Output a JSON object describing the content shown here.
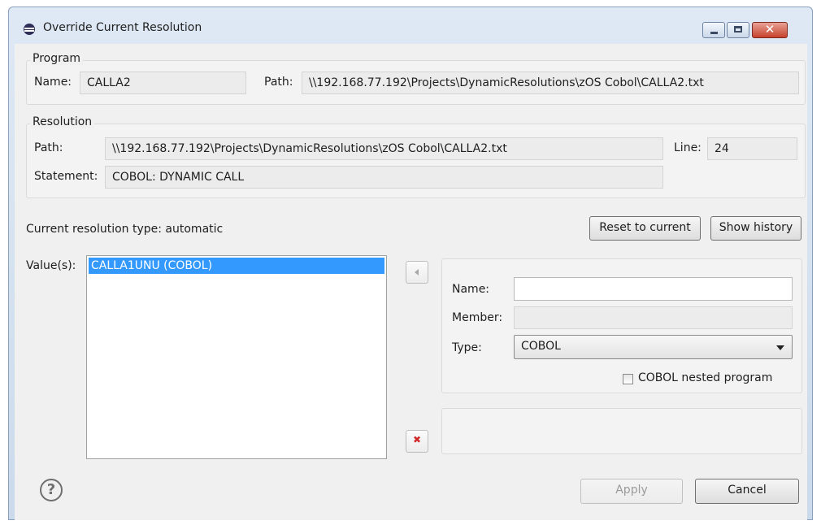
{
  "window": {
    "title": "Override Current Resolution",
    "close_glyph": "✕"
  },
  "program": {
    "group_label": "Program",
    "name_label": "Name:",
    "name_value": "CALLA2",
    "path_label": "Path:",
    "path_value": "\\\\192.168.77.192\\Projects\\DynamicResolutions\\zOS Cobol\\CALLA2.txt"
  },
  "resolution": {
    "group_label": "Resolution",
    "path_label": "Path:",
    "path_value": "\\\\192.168.77.192\\Projects\\DynamicResolutions\\zOS Cobol\\CALLA2.txt",
    "line_label": "Line:",
    "line_value": "24",
    "statement_label": "Statement:",
    "statement_value": "COBOL: DYNAMIC CALL"
  },
  "current_type_text": "Current resolution type: automatic",
  "buttons": {
    "reset": "Reset to current",
    "history": "Show history",
    "apply": "Apply",
    "cancel": "Cancel"
  },
  "values": {
    "label": "Value(s):",
    "items": [
      "CALLA1UNU (COBOL)"
    ]
  },
  "detail": {
    "name_label": "Name:",
    "name_value": "",
    "member_label": "Member:",
    "member_value": "",
    "type_label": "Type:",
    "type_value": "COBOL",
    "nested_label": "COBOL nested program",
    "nested_checked": false
  },
  "icons": {
    "help": "?",
    "remove": "✖"
  },
  "colors": {
    "selection": "#3399ff",
    "close_button": "#c7422d",
    "remove_icon": "#d12a2a"
  }
}
